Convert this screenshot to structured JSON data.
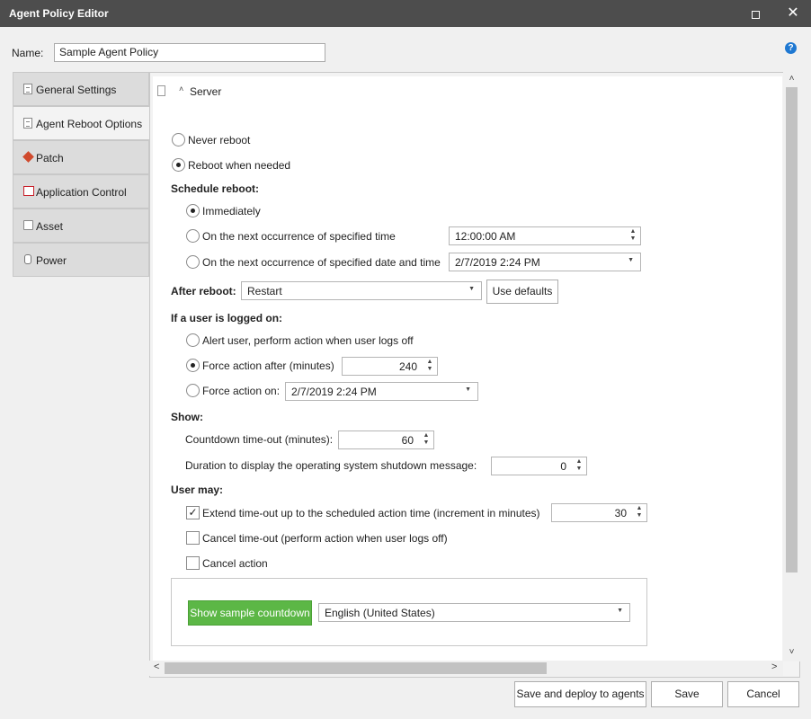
{
  "window": {
    "title": "Agent Policy Editor",
    "maximize_icon": "maximize-icon",
    "close_icon": "close-icon",
    "close_glyph": "✕"
  },
  "name_label": "Name:",
  "name_value": "Sample Agent Policy",
  "help_glyph": "?",
  "tabs": [
    {
      "label": "General Settings",
      "icon": "document-icon"
    },
    {
      "label": "Agent Reboot Options",
      "icon": "document-icon"
    },
    {
      "label": "Patch",
      "icon": "patch-icon"
    },
    {
      "label": "Application Control",
      "icon": "application-control-icon"
    },
    {
      "label": "Asset",
      "icon": "asset-icon"
    },
    {
      "label": "Power",
      "icon": "power-icon"
    }
  ],
  "section": {
    "caret": "˄",
    "title": "Server"
  },
  "reboot": {
    "never": "Never reboot",
    "when_needed": "Reboot when needed"
  },
  "schedule": {
    "header": "Schedule reboot:",
    "immediately": "Immediately",
    "next_time": "On the next occurrence of specified time",
    "time_value": "12:00:00 AM",
    "next_datetime": "On the next occurrence of specified date and time",
    "datetime_value": "2/7/2019 2:24 PM"
  },
  "after_reboot": {
    "label": "After reboot:",
    "value": "Restart",
    "defaults_button": "Use defaults"
  },
  "logged_on": {
    "header": "If a user is logged on:",
    "alert": "Alert user, perform action when user logs off",
    "force_after": "Force action after (minutes)",
    "force_after_value": "240",
    "force_on": "Force action on:",
    "force_on_value": "2/7/2019 2:24 PM"
  },
  "show": {
    "header": "Show:",
    "countdown": "Countdown time-out (minutes):",
    "countdown_value": "60",
    "duration": "Duration to display the operating system shutdown message:",
    "duration_value": "0"
  },
  "user_may": {
    "header": "User may:",
    "extend": "Extend time-out up to the scheduled action time (increment in minutes)",
    "extend_value": "30",
    "cancel_timeout": "Cancel time-out (perform action when user logs off)",
    "cancel_action": "Cancel action"
  },
  "sample": {
    "button": "Show sample countdown",
    "language": "English (United States)"
  },
  "glyphs": {
    "spin_up": "▲",
    "spin_down": "▼",
    "dropdown": "▼",
    "check": "✓",
    "scroll_up": "˄",
    "scroll_down": "˅",
    "scroll_left": "<",
    "scroll_right": ">"
  },
  "footer": {
    "deploy": "Save and deploy to agents",
    "save": "Save",
    "cancel": "Cancel"
  }
}
